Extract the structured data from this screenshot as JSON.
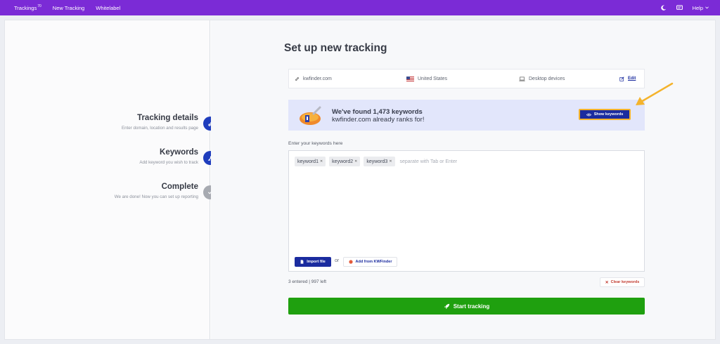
{
  "topbar": {
    "nav": [
      {
        "label": "Trackings",
        "badge": "70"
      },
      {
        "label": "New Tracking"
      },
      {
        "label": "Whitelabel"
      }
    ],
    "help_label": "Help"
  },
  "steps": [
    {
      "title": "Tracking details",
      "subtitle": "Enter domain, location and results page"
    },
    {
      "title": "Keywords",
      "subtitle": "Add keyword you wish to track"
    },
    {
      "title": "Complete",
      "subtitle": "We are done! Now you can set up reporting"
    }
  ],
  "page_title": "Set up new tracking",
  "settings": {
    "domain": "kwfinder.com",
    "location": "United States",
    "device": "Desktop devices",
    "edit_label": "Edit"
  },
  "banner": {
    "line1": "We've found 1,473 keywords",
    "line2": "kwfinder.com already ranks for!",
    "button_label": "Show keywords"
  },
  "keywords": {
    "label": "Enter your keywords here",
    "chips": [
      "keyword1",
      "keyword2",
      "keyword3"
    ],
    "placeholder": "separate with Tab or Enter",
    "import_label": "Import file",
    "or_label": "or",
    "add_label": "Add from KWFinder"
  },
  "counter": "3 entered | 997 left",
  "clear_label": "Clear keywords",
  "start_label": "Start tracking",
  "colors": {
    "topbar": "#7b2bd6",
    "primary": "#1b2c9f",
    "step_active": "#1f3dbd",
    "success": "#1fa00f",
    "highlight": "#f4b32c",
    "danger": "#c23b30"
  }
}
